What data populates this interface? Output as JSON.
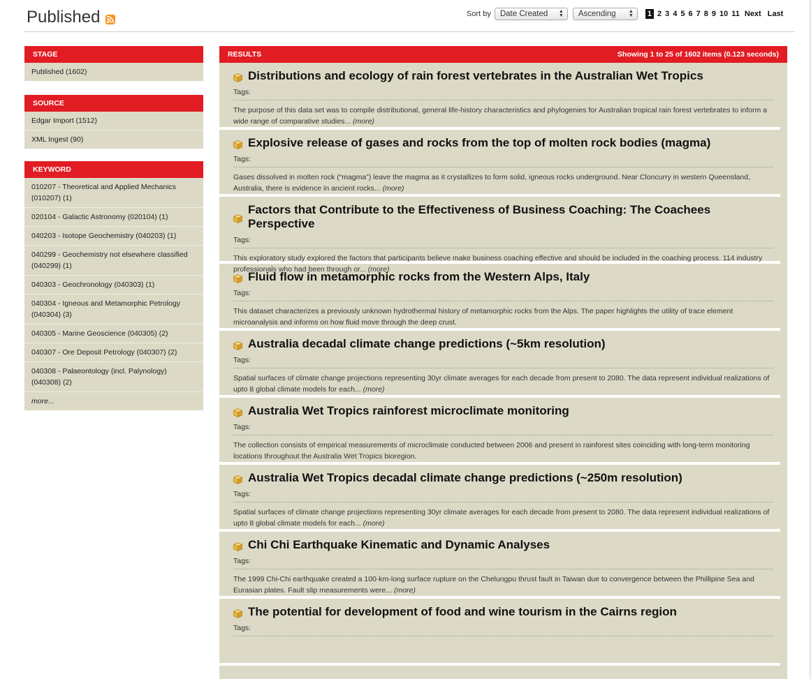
{
  "header": {
    "title": "Published",
    "sort_label": "Sort by",
    "sort_value": "Date Created",
    "order_value": "Ascending",
    "pages": [
      "1",
      "2",
      "3",
      "4",
      "5",
      "6",
      "7",
      "8",
      "9",
      "10",
      "11"
    ],
    "current_page": "1",
    "next_label": "Next",
    "last_label": "Last"
  },
  "facets": {
    "stage": {
      "title": "STAGE",
      "items": [
        "Published (1602)"
      ]
    },
    "source": {
      "title": "SOURCE",
      "items": [
        "Edgar Import (1512)",
        "XML Ingest (90)"
      ]
    },
    "keyword": {
      "title": "KEYWORD",
      "items": [
        "010207 - Theoretical and Applied Mechanics (010207) (1)",
        "020104 - Galactic Astronomy (020104) (1)",
        "040203 - Isotope Geochemistry (040203) (1)",
        "040299 - Geochemistry not elsewhere classified (040299) (1)",
        "040303 - Geochronology (040303) (1)",
        "040304 - Igneous and Metamorphic Petrology (040304) (3)",
        "040305 - Marine Geoscience (040305) (2)",
        "040307 - Ore Deposit Petrology (040307) (2)",
        "040308 - Palaeontology (incl. Palynology) (040308) (2)"
      ],
      "more_label": "more..."
    }
  },
  "results": {
    "title": "RESULTS",
    "summary": "Showing 1 to 25 of 1602 items (0.123 seconds)",
    "tags_label": "Tags:",
    "more_label": "(more)",
    "items": [
      {
        "title": "Distributions and ecology of rain forest vertebrates in the Australian Wet Tropics",
        "description": "The purpose of this data set was to compile distributional, general life-history characteristics and phylogenies for Australian tropical rain forest vertebrates to inform a wide range of comparative studies..."
      },
      {
        "title": "Explosive release of gases and rocks from the top of molten rock bodies (magma)",
        "description": "Gases dissolved in molten rock (“magma”) leave the magma as it crystallizes to form solid, igneous rocks underground. Near Cloncurry in western Queensland, Australia, there is evidence in ancient rocks..."
      },
      {
        "title": "Factors that Contribute to the Effectiveness of Business Coaching: The Coachees Perspective",
        "description": "This exploratory study explored the factors that participants believe make business coaching effective and should be included in the coaching process. 114 industry professionals who had been through or..."
      },
      {
        "title": "Fluid flow in metamorphic rocks from the Western Alps, Italy",
        "description": "This dataset characterizes a previously unknown hydrothermal history of metamorphic rocks from the Alps. The paper highlights the utility of trace element microanalysis and informs on how fluid move through the deep crust."
      },
      {
        "title": "Australia decadal climate change predictions (~5km resolution)",
        "description": "Spatial surfaces of climate change projections representing 30yr climate averages for each decade from present to 2080. The data represent individual realizations of upto 8 global climate models for each..."
      },
      {
        "title": "Australia Wet Tropics rainforest microclimate monitoring",
        "description": "The collection consists of empirical measurements of microclimate conducted between 2006 and present in rainforest sites coinciding with long-term monitoring locations throughout the Australia Wet Tropics bioregion."
      },
      {
        "title": "Australia Wet Tropics decadal climate change predictions (~250m resolution)",
        "description": "Spatial surfaces of climate change projections representing 30yr climate averages for each decade from present to 2080. The data represent individual realizations of upto 8 global climate models for each..."
      },
      {
        "title": "Chi Chi Earthquake Kinematic and Dynamic Analyses",
        "description": "The 1999 Chi-Chi earthquake created a 100-km-long surface rupture on the Chelungpu thrust fault in Taiwan due to convergence between the Phillipine Sea and Eurasian plates. Fault slip measurements were..."
      },
      {
        "title": "The potential for development of food and wine tourism in the Cairns region",
        "description": ""
      }
    ],
    "more_flags": [
      true,
      true,
      true,
      false,
      true,
      false,
      true,
      true,
      false
    ]
  },
  "icons": {
    "rss": "rss-feed-icon",
    "item": "dataset-box-icon"
  },
  "colors": {
    "accent": "#e21c23",
    "panel": "#dcdac6"
  }
}
